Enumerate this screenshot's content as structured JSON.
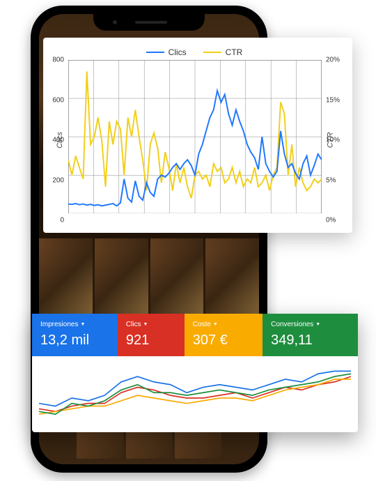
{
  "chart_data": {
    "type": "line",
    "x_ticks_count": 10,
    "ylim_left": [
      0,
      800
    ],
    "y_left_ticks": [
      "0",
      "200",
      "400",
      "600",
      "800"
    ],
    "ylim_right": [
      0,
      20
    ],
    "y_right_ticks": [
      "0%",
      "5%",
      "10%",
      "15%",
      "20%"
    ],
    "ylabel_left": "Clics",
    "ylabel_right": "CTR",
    "legend": [
      {
        "name": "Clics",
        "color": "#1f77ff"
      },
      {
        "name": "CTR",
        "color": "#f2cf18"
      }
    ],
    "series": [
      {
        "name": "Clics",
        "color": "#1f77ff",
        "values": [
          50,
          48,
          52,
          46,
          50,
          44,
          48,
          42,
          46,
          40,
          44,
          48,
          52,
          40,
          56,
          180,
          80,
          60,
          170,
          90,
          70,
          160,
          110,
          90,
          180,
          200,
          190,
          210,
          240,
          260,
          230,
          260,
          280,
          250,
          200,
          310,
          360,
          430,
          500,
          540,
          640,
          580,
          620,
          520,
          460,
          540,
          480,
          430,
          360,
          320,
          290,
          230,
          400,
          260,
          220,
          190,
          220,
          430,
          310,
          240,
          260,
          210,
          180,
          260,
          300,
          200,
          250,
          310,
          280
        ]
      },
      {
        "name": "CTR",
        "color": "#f2cf18",
        "values": [
          7.0,
          5.0,
          7.5,
          6.0,
          4.5,
          18.5,
          9.0,
          10.0,
          12.5,
          9.5,
          3.5,
          12.0,
          9.0,
          12.0,
          11.0,
          5.0,
          12.5,
          10.0,
          13.5,
          10.0,
          7.0,
          3.0,
          9.0,
          10.5,
          8.5,
          4.0,
          8.0,
          6.0,
          3.0,
          6.5,
          4.0,
          6.0,
          3.5,
          2.0,
          5.0,
          5.5,
          4.5,
          5.0,
          3.5,
          6.5,
          5.5,
          6.0,
          4.0,
          4.5,
          6.0,
          4.0,
          5.5,
          3.5,
          4.5,
          4.0,
          6.0,
          3.5,
          4.0,
          5.0,
          3.0,
          5.0,
          6.0,
          14.5,
          13.0,
          5.0,
          9.0,
          3.5,
          6.0,
          4.0,
          3.0,
          3.5,
          4.5,
          4.0,
          4.5
        ]
      }
    ]
  },
  "metrics": [
    {
      "label": "Impresiones",
      "value": "13,2 mil",
      "color": "blue"
    },
    {
      "label": "Clics",
      "value": "921",
      "color": "red"
    },
    {
      "label": "Coste",
      "value": "307 €",
      "color": "orange"
    },
    {
      "label": "Conversiones",
      "value": "349,11",
      "color": "green"
    }
  ],
  "sparkline": {
    "series": [
      {
        "color": "#1a73e8",
        "values": [
          18,
          17,
          20,
          19,
          21,
          26,
          28,
          26,
          25,
          22,
          24,
          25,
          24,
          23,
          25,
          27,
          26,
          29,
          30,
          30
        ]
      },
      {
        "color": "#d93025",
        "values": [
          16,
          15,
          17,
          18,
          18,
          22,
          24,
          23,
          21,
          20,
          20,
          21,
          22,
          20,
          22,
          24,
          23,
          25,
          26,
          28
        ]
      },
      {
        "color": "#f9ab00",
        "values": [
          14,
          15,
          16,
          17,
          17,
          19,
          21,
          20,
          19,
          18,
          19,
          20,
          20,
          19,
          21,
          23,
          24,
          25,
          27,
          27
        ]
      },
      {
        "color": "#1e8e3e",
        "values": [
          15,
          14,
          18,
          17,
          19,
          23,
          25,
          22,
          22,
          21,
          22,
          23,
          22,
          21,
          23,
          24,
          25,
          26,
          28,
          29
        ]
      }
    ],
    "ylim": [
      10,
      34
    ]
  }
}
